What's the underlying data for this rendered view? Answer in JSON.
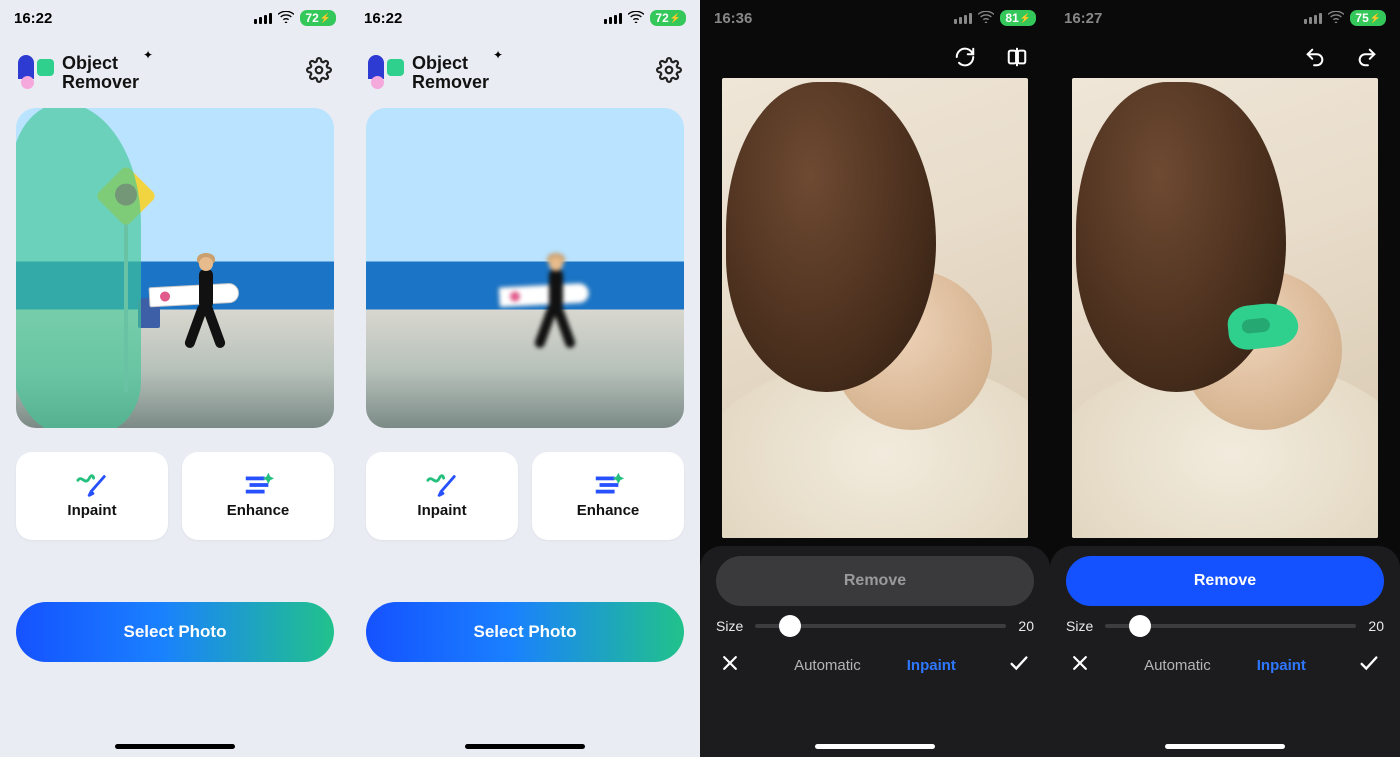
{
  "panels": [
    {
      "status": {
        "time": "16:22",
        "battery": "72"
      },
      "app_title_line1": "Object",
      "app_title_line2": "Remover",
      "actions": {
        "inpaint": "Inpaint",
        "enhance": "Enhance"
      },
      "select_label": "Select Photo",
      "preview_has_mask": true
    },
    {
      "status": {
        "time": "16:22",
        "battery": "72"
      },
      "app_title_line1": "Object",
      "app_title_line2": "Remover",
      "actions": {
        "inpaint": "Inpaint",
        "enhance": "Enhance"
      },
      "select_label": "Select Photo",
      "preview_has_mask": false
    },
    {
      "status": {
        "time": "16:36",
        "battery": "81"
      },
      "remove_label": "Remove",
      "remove_enabled": false,
      "size_label": "Size",
      "size_value": "20",
      "tabs": {
        "auto": "Automatic",
        "inpaint": "Inpaint",
        "active": "inpaint"
      },
      "top_icons": [
        "refresh",
        "compare"
      ],
      "canvas_paint_mark": false
    },
    {
      "status": {
        "time": "16:27",
        "battery": "75"
      },
      "remove_label": "Remove",
      "remove_enabled": true,
      "size_label": "Size",
      "size_value": "20",
      "tabs": {
        "auto": "Automatic",
        "inpaint": "Inpaint",
        "active": "inpaint"
      },
      "top_icons": [
        "undo",
        "redo"
      ],
      "canvas_paint_mark": true
    }
  ]
}
